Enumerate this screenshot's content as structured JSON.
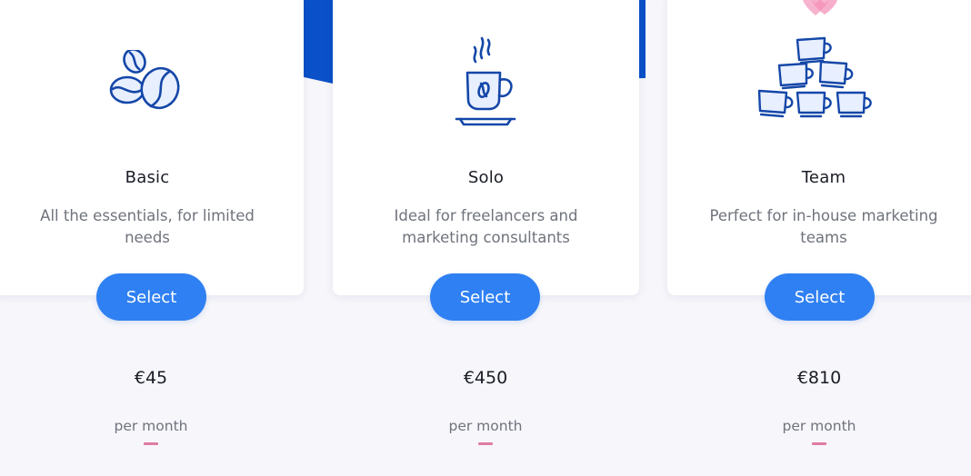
{
  "plans": [
    {
      "name": "Basic",
      "description": "All the essentials, for limited needs",
      "button_label": "Select",
      "price": "€45",
      "period": "per month",
      "icon": "coffee-beans-icon"
    },
    {
      "name": "Solo",
      "description": "Ideal for freelancers and marketing consultants",
      "button_label": "Select",
      "price": "€450",
      "period": "per month",
      "icon": "coffee-cup-icon"
    },
    {
      "name": "Team",
      "description": "Perfect for in-house marketing teams",
      "button_label": "Select",
      "price": "€810",
      "period": "per month",
      "icon": "stacked-cups-icon"
    }
  ],
  "colors": {
    "accent": "#2f80f2",
    "brand_blue": "#0a50c8",
    "icon_blue": "#1447a8",
    "heart_pink": "#f6a7c6",
    "dash_pink": "#e07ba3",
    "background": "#f6f6fb"
  }
}
